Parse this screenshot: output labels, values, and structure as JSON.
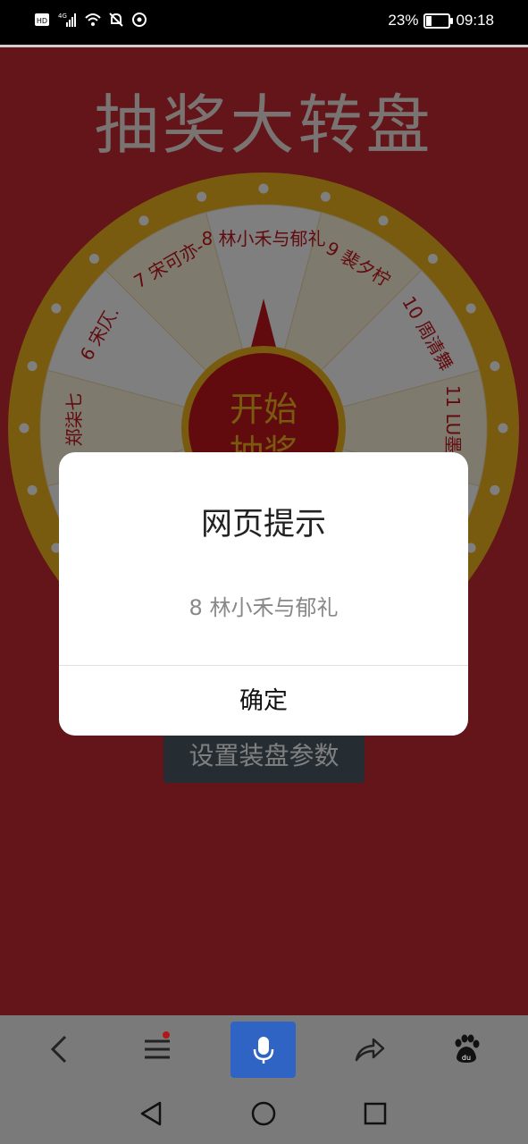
{
  "status_bar": {
    "battery_percent": "23%",
    "battery_level": 0.23,
    "time": "09:18",
    "icons": [
      "hd-icon",
      "signal-4g-icon",
      "wifi-icon",
      "mute-bell-icon",
      "sync-icon",
      "battery-icon"
    ]
  },
  "page": {
    "title": "抽奖大转盘",
    "setup_button": "设置装盘参数",
    "wheel": {
      "center_label_line1": "开始",
      "center_label_line2": "抽奖",
      "segments": [
        {
          "label": "8 林小禾与郁礼",
          "color": "#ffffff"
        },
        {
          "label": "9 裴夕柠",
          "color": "#fff4dc"
        },
        {
          "label": "10 周清舞",
          "color": "#ffffff"
        },
        {
          "label": "11 LU墨叶",
          "color": "#fff4dc"
        },
        {
          "label": "",
          "color": "#ffffff"
        },
        {
          "label": "",
          "color": "#fff4dc"
        },
        {
          "label": "",
          "color": "#ffffff"
        },
        {
          "label": "",
          "color": "#fff4dc"
        },
        {
          "label": "",
          "color": "#ffffff"
        },
        {
          "label": "5 郑柒七",
          "color": "#fff4dc"
        },
        {
          "label": "6 宋仄.",
          "color": "#ffffff"
        },
        {
          "label": "7 宋可亦-",
          "color": "#fff4dc"
        }
      ],
      "rim_color": "#f3b61f",
      "pointer_color": "#c4161c"
    }
  },
  "dialog": {
    "title": "网页提示",
    "message": "8 林小禾与郁礼",
    "confirm_label": "确定"
  },
  "browser_toolbar": {
    "items": [
      "back-icon",
      "menu-icon",
      "voice-search-icon",
      "share-icon",
      "baidu-paw-icon"
    ]
  },
  "system_nav": {
    "items": [
      "nav-back-icon",
      "nav-home-icon",
      "nav-recents-icon"
    ]
  }
}
